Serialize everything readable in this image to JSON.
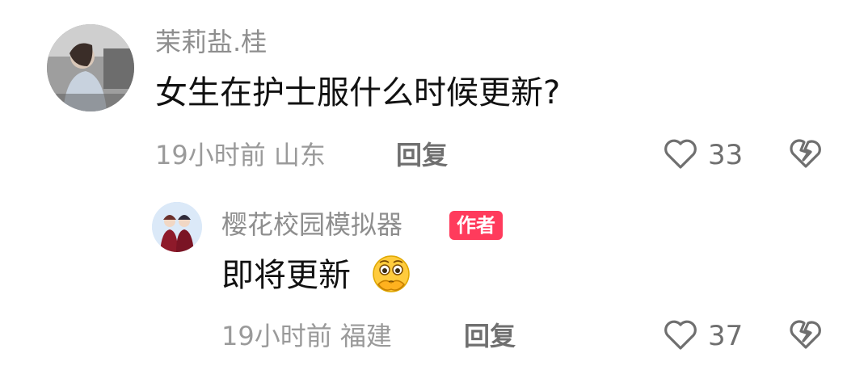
{
  "comment": {
    "username": "茉莉盐.桂",
    "text": "女生在护士服什么时候更新?",
    "time_location": "19小时前 山东",
    "reply_label": "回复",
    "like_count": "33"
  },
  "reply": {
    "username": "樱花校园模拟器",
    "author_badge": "作者",
    "text": "即将更新",
    "emoji_icon": "hand-over-mouth-face-emoji",
    "time_location": "19小时前 福建",
    "reply_label": "回复",
    "like_count": "37"
  },
  "colors": {
    "badge": "#ff3b5c",
    "text_primary": "#111111",
    "text_secondary": "#8e8e8e"
  }
}
